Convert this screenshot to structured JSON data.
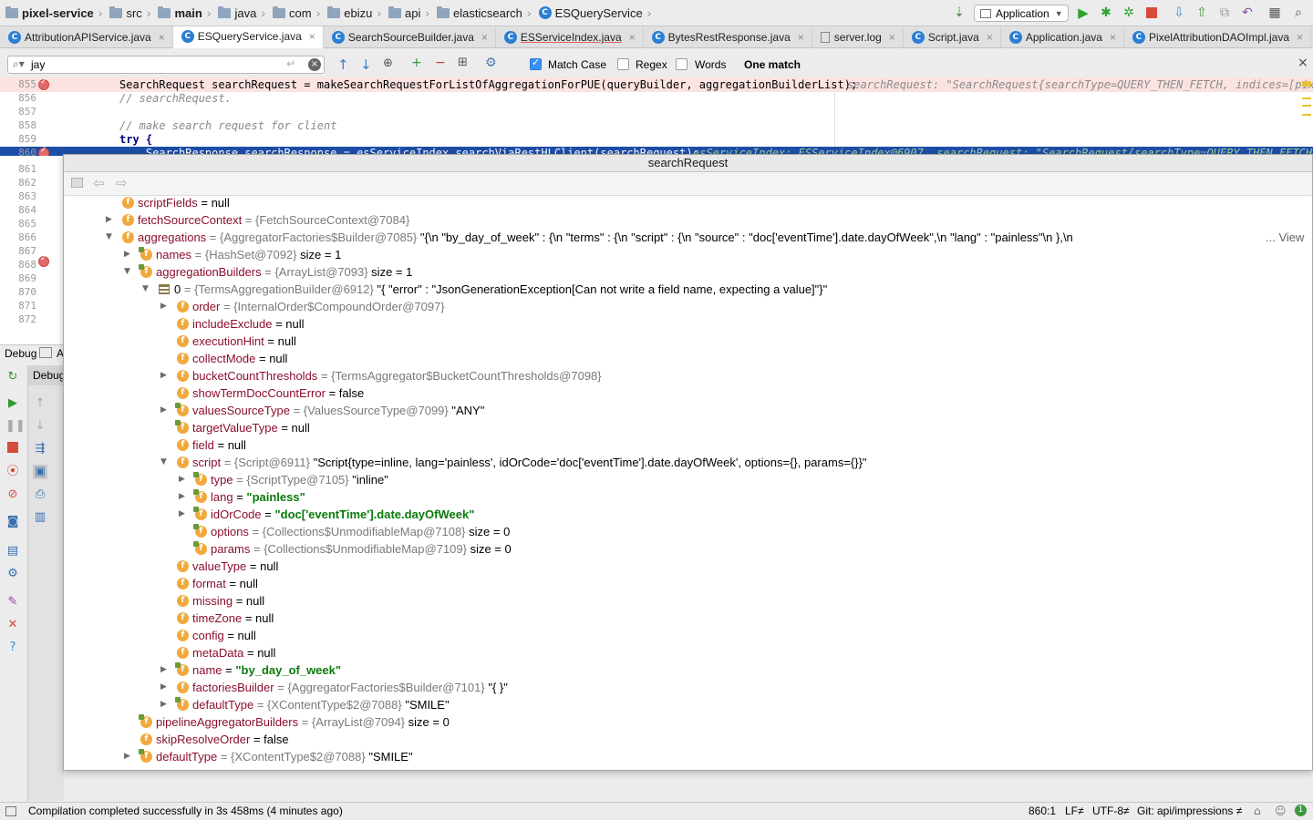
{
  "breadcrumbs": [
    "pixel-service",
    "src",
    "main",
    "java",
    "com",
    "ebizu",
    "api",
    "elasticsearch",
    "ESQueryService"
  ],
  "run_config": "Application",
  "tabs": [
    "AttributionAPIService.java",
    "ESQueryService.java",
    "SearchSourceBuilder.java",
    "ESServiceIndex.java",
    "BytesRestResponse.java",
    "server.log",
    "Script.java",
    "Application.java",
    "PixelAttributionDAOImpl.java"
  ],
  "search": {
    "query": "jay",
    "match_case_label": "Match Case",
    "regex_label": "Regex",
    "words_label": "Words",
    "result": "One match",
    "match_case_checked": true
  },
  "editor": {
    "line_numbers": [
      "855",
      "856",
      "857",
      "858",
      "859",
      "860",
      "861",
      "862",
      "863",
      "864",
      "865",
      "866",
      "867",
      "868",
      "869",
      "870",
      "871",
      "872"
    ],
    "lines": [
      "SearchRequest searchRequest = makeSearchRequestForListOfAggregationForPUE(queryBuilder, aggregationBuilderList);",
      "// searchRequest.",
      "",
      "// make search request for client",
      "try {",
      "    SearchResponse searchResponse = esServiceIndex.searchViaRestHLClient(searchRequest);"
    ],
    "inline_value_855": "searchRequest: \"SearchRequest{searchType=QUERY_THEN_FETCH, indices=[pix",
    "inline_value_860": "esServiceIndex: ESServiceIndex@6907  searchRequest: \"SearchRequest{searchType=QUERY_THEN_FETCH"
  },
  "debug": {
    "tab_label": "Debug",
    "sub_label": "Debug",
    "other_tab": "A"
  },
  "popup": {
    "title": "searchRequest",
    "view_link": "... View",
    "rows": [
      {
        "name": "scriptFields",
        "type": "",
        "value": "= null"
      },
      {
        "name": "fetchSourceContext",
        "type": "= {FetchSourceContext@7084}",
        "value": ""
      },
      {
        "name": "aggregations",
        "type": "= {AggregatorFactories$Builder@7085}",
        "value": "\"{\\n  \"by_day_of_week\" : {\\n    \"terms\" : {\\n      \"script\" : {\\n        \"source\" : \"doc['eventTime'].date.dayOfWeek\",\\n        \"lang\" : \"painless\"\\n      },\\n"
      },
      {
        "name": "names",
        "type": "= {HashSet@7092}",
        "value": " size = 1"
      },
      {
        "name": "aggregationBuilders",
        "type": "= {ArrayList@7093}",
        "value": " size = 1"
      },
      {
        "name": "0",
        "type": "= {TermsAggregationBuilder@6912}",
        "value": "\"{ \"error\" : \"JsonGenerationException[Can not write a field name, expecting a value]\"}\""
      },
      {
        "name": "order",
        "type": "= {InternalOrder$CompoundOrder@7097}",
        "value": ""
      },
      {
        "name": "includeExclude",
        "type": "",
        "value": "= null"
      },
      {
        "name": "executionHint",
        "type": "",
        "value": "= null"
      },
      {
        "name": "collectMode",
        "type": "",
        "value": "= null"
      },
      {
        "name": "bucketCountThresholds",
        "type": "= {TermsAggregator$BucketCountThresholds@7098}",
        "value": ""
      },
      {
        "name": "showTermDocCountError",
        "type": "",
        "value": "= false"
      },
      {
        "name": "valuesSourceType",
        "type": "= {ValuesSourceType@7099}",
        "value": "\"ANY\""
      },
      {
        "name": "targetValueType",
        "type": "",
        "value": "= null"
      },
      {
        "name": "field",
        "type": "",
        "value": "= null"
      },
      {
        "name": "script",
        "type": "= {Script@6911}",
        "value": "\"Script{type=inline, lang='painless', idOrCode='doc['eventTime'].date.dayOfWeek', options={}, params={}}\""
      },
      {
        "name": "type",
        "type": "= {ScriptType@7105}",
        "value": "\"inline\""
      },
      {
        "name": "lang",
        "type": "= ",
        "value": "\"painless\""
      },
      {
        "name": "idOrCode",
        "type": "= ",
        "value": "\"doc['eventTime'].date.dayOfWeek\""
      },
      {
        "name": "options",
        "type": "= {Collections$UnmodifiableMap@7108}",
        "value": " size = 0"
      },
      {
        "name": "params",
        "type": "= {Collections$UnmodifiableMap@7109}",
        "value": " size = 0"
      },
      {
        "name": "valueType",
        "type": "",
        "value": "= null"
      },
      {
        "name": "format",
        "type": "",
        "value": "= null"
      },
      {
        "name": "missing",
        "type": "",
        "value": "= null"
      },
      {
        "name": "timeZone",
        "type": "",
        "value": "= null"
      },
      {
        "name": "config",
        "type": "",
        "value": "= null"
      },
      {
        "name": "metaData",
        "type": "",
        "value": "= null"
      },
      {
        "name": "name",
        "type": "= ",
        "value": "\"by_day_of_week\""
      },
      {
        "name": "factoriesBuilder",
        "type": "= {AggregatorFactories$Builder@7101}",
        "value": "\"{ }\""
      },
      {
        "name": "defaultType",
        "type": "= {XContentType$2@7088}",
        "value": "\"SMILE\""
      },
      {
        "name": "pipelineAggregatorBuilders",
        "type": "= {ArrayList@7094}",
        "value": " size = 0"
      },
      {
        "name": "skipResolveOrder",
        "type": "",
        "value": "= false"
      },
      {
        "name": "defaultType",
        "type": "= {XContentType$2@7088}",
        "value": "\"SMILE\""
      }
    ]
  },
  "status": {
    "message": "Compilation completed successfully in 3s 458ms (4 minutes ago)",
    "position": "860:1",
    "line_sep": "LF≠",
    "encoding": "UTF-8≠",
    "git": "Git: api/impressions ≠"
  },
  "colors": {
    "field_name": "#8b0f2c",
    "type_gray": "#7a7a7a",
    "string_green": "#0b7a0b",
    "field_icon": "#f2a93b",
    "selection": "#1d4ea8"
  }
}
